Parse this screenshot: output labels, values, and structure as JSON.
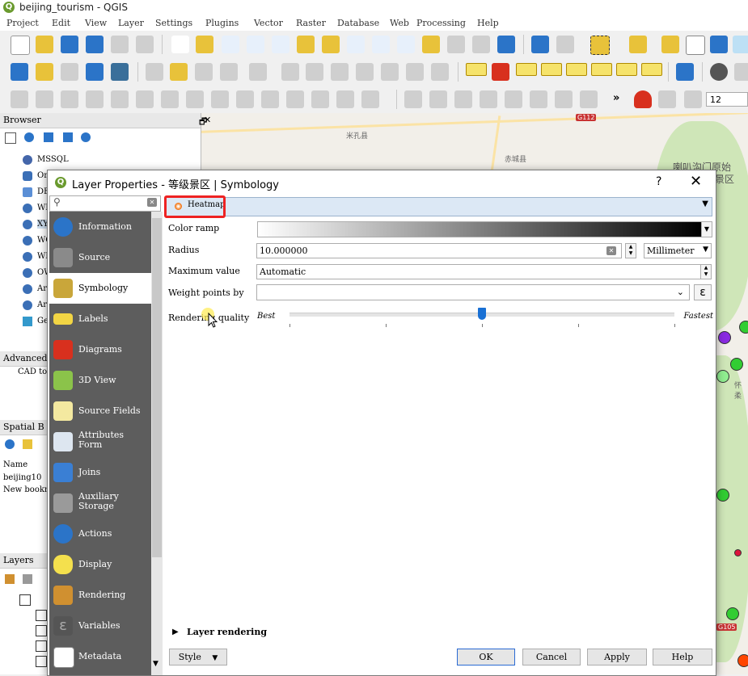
{
  "window": {
    "title": "beijing_tourism - QGIS"
  },
  "menu": [
    "Project",
    "Edit",
    "View",
    "Layer",
    "Settings",
    "Plugins",
    "Vector",
    "Raster",
    "Database",
    "Web",
    "Processing",
    "Help"
  ],
  "toolbar": {
    "scale_value": "12"
  },
  "map": {
    "road_shields": [
      "G112",
      "G105"
    ],
    "place_labels": [
      "米孔县",
      "赤城县",
      "喇叭沟门原始",
      "景区",
      "怀柔"
    ],
    "point_colors": [
      "#8a2be2",
      "#32cd32",
      "#90ee90",
      "#32cd32",
      "#dc143c",
      "#ff4500"
    ]
  },
  "browser": {
    "title": "Browser",
    "items": [
      "MSSQL",
      "Or",
      "DB",
      "WM",
      "XY",
      "WC",
      "WF",
      "OW",
      "Ar",
      "Ar",
      "Ge"
    ]
  },
  "advanced": {
    "title": "Advanced",
    "line": "CAD to"
  },
  "spatial": {
    "title": "Spatial B",
    "col_name": "Name",
    "row1": "beijing10",
    "row2": "New bookm"
  },
  "layers": {
    "title": "Layers"
  },
  "dialog": {
    "title": "Layer Properties - 等级景区 | Symbology",
    "help": "?",
    "close": "✕",
    "search_placeholder": "",
    "sidebar": [
      {
        "label": "Information",
        "icon": "information-icon",
        "color": "#2b74c8"
      },
      {
        "label": "Source",
        "icon": "source-wrench-icon",
        "color": "#6b6b6b"
      },
      {
        "label": "Symbology",
        "icon": "symbology-brush-icon",
        "color": "#c9a63a"
      },
      {
        "label": "Labels",
        "icon": "labels-abc-icon",
        "color": "#f2d544"
      },
      {
        "label": "Diagrams",
        "icon": "diagrams-icon",
        "color": "#d8301e"
      },
      {
        "label": "3D View",
        "icon": "3d-cube-icon",
        "color": "#8bc34a"
      },
      {
        "label": "Source Fields",
        "icon": "source-fields-icon",
        "color": "#f4e9a0"
      },
      {
        "label": "Attributes Form",
        "icon": "attributes-form-icon",
        "color": "#dde6f0"
      },
      {
        "label": "Joins",
        "icon": "joins-icon",
        "color": "#3a7fd4"
      },
      {
        "label": "Auxiliary Storage",
        "icon": "auxiliary-storage-icon",
        "color": "#9a9a9a"
      },
      {
        "label": "Actions",
        "icon": "actions-gear-icon",
        "color": "#2b74c8"
      },
      {
        "label": "Display",
        "icon": "display-speech-icon",
        "color": "#f4e04d"
      },
      {
        "label": "Rendering",
        "icon": "rendering-brush-icon",
        "color": "#d09030"
      },
      {
        "label": "Variables",
        "icon": "variables-epsilon-icon",
        "color": "#555555"
      },
      {
        "label": "Metadata",
        "icon": "metadata-icon",
        "color": "#e85040"
      }
    ],
    "renderer": "Heatmap",
    "fields": {
      "color_ramp_label": "Color ramp",
      "radius_label": "Radius",
      "radius_value": "10.000000",
      "radius_units": "Millimeter",
      "max_value_label": "Maximum value",
      "max_value": "Automatic",
      "weight_label": "Weight points by",
      "weight_value": "",
      "quality_label": "Rendering quality",
      "quality_best": "Best",
      "quality_fastest": "Fastest",
      "quality_level": 0.5
    },
    "layer_rendering": "Layer rendering",
    "buttons": {
      "style": "Style",
      "ok": "OK",
      "cancel": "Cancel",
      "apply": "Apply",
      "help": "Help"
    }
  }
}
